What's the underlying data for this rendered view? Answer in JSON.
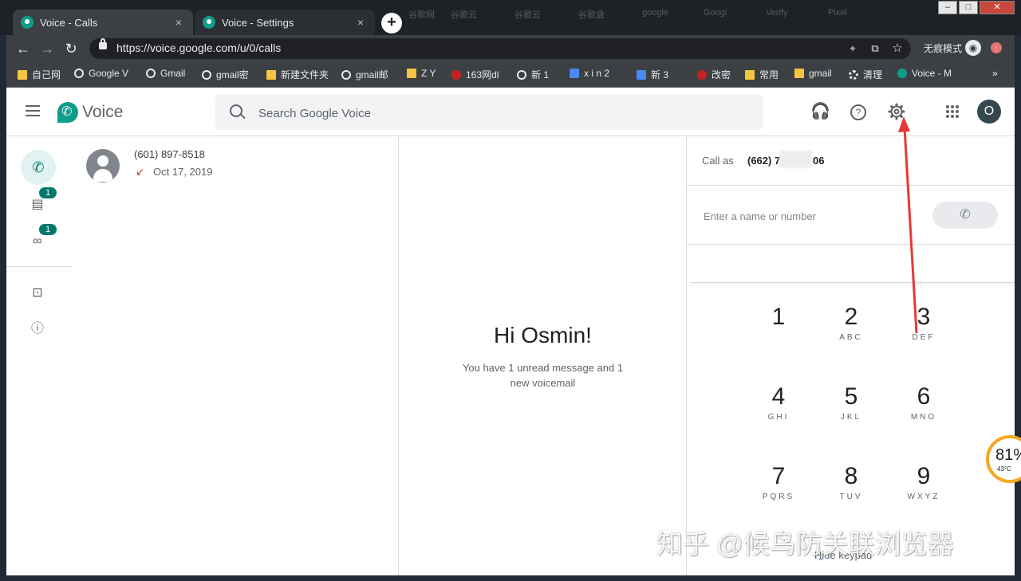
{
  "browser": {
    "tabs": [
      {
        "title": "Voice - Calls",
        "close": "×"
      },
      {
        "title": "Voice - Settings",
        "close": "×"
      }
    ],
    "new_tab": "+",
    "background_tabs": [
      "谷歌网",
      "谷歌云",
      "谷歌云",
      "谷歌盘",
      "google",
      "Googl",
      "Verify",
      "Pixel"
    ],
    "window_controls": {
      "minimize": "–",
      "maximize": "□",
      "close": "✕"
    },
    "back": "←",
    "forward": "→",
    "reload": "↻",
    "url": "https://voice.google.com/u/0/calls",
    "incognito_label": "无痕模式",
    "bookmarks": [
      {
        "label": "自己网",
        "icon": "folder"
      },
      {
        "label": "Google V",
        "icon": "g"
      },
      {
        "label": "Gmail",
        "icon": "g"
      },
      {
        "label": "gmail密",
        "icon": "g"
      },
      {
        "label": "新建文件夹",
        "icon": "folder"
      },
      {
        "label": "gmail邮",
        "icon": "g"
      },
      {
        "label": "Z Y",
        "icon": "folder"
      },
      {
        "label": "163网dl",
        "icon": "red"
      },
      {
        "label": "新  1",
        "icon": "g"
      },
      {
        "label": "x i n 2",
        "icon": "blue"
      },
      {
        "label": "新    3",
        "icon": "blue"
      },
      {
        "label": "改密",
        "icon": "red"
      },
      {
        "label": "常用",
        "icon": "folder"
      },
      {
        "label": "gmail",
        "icon": "folder"
      },
      {
        "label": "清理",
        "icon": "gear"
      },
      {
        "label": "Voice - M",
        "icon": "voice"
      }
    ],
    "bookmarks_more": "»"
  },
  "app": {
    "brand": "Voice",
    "search_placeholder": "Search Google Voice",
    "avatar_letter": "O",
    "nav": {
      "messages_badge": "1",
      "voicemail_badge": "1"
    },
    "calls": [
      {
        "number": "(601) 897-8518",
        "date": "Oct 17, 2019",
        "type": "missed"
      }
    ],
    "greeting": "Hi Osmin!",
    "greeting_sub": "You have 1 unread message and 1 new voicemail",
    "dialer": {
      "call_as_label": "Call as",
      "call_as_number": "(662) 7",
      "call_as_suffix": "06",
      "input_placeholder": "Enter a name or number",
      "keys": [
        {
          "digit": "1",
          "letters": ""
        },
        {
          "digit": "2",
          "letters": "ABC"
        },
        {
          "digit": "3",
          "letters": "DEF"
        },
        {
          "digit": "4",
          "letters": "GHI"
        },
        {
          "digit": "5",
          "letters": "JKL"
        },
        {
          "digit": "6",
          "letters": "MNO"
        },
        {
          "digit": "7",
          "letters": "PQRS"
        },
        {
          "digit": "8",
          "letters": "TUV"
        },
        {
          "digit": "9",
          "letters": "WXYZ"
        }
      ],
      "hide_keypad": "Hide keypad"
    }
  },
  "widget": {
    "value": "81%",
    "temp": "43°C"
  },
  "watermark": "知乎 @候鸟防关联浏览器",
  "colors": {
    "accent": "#00796b",
    "arrow": "#e53935",
    "missed": "#d93025"
  }
}
